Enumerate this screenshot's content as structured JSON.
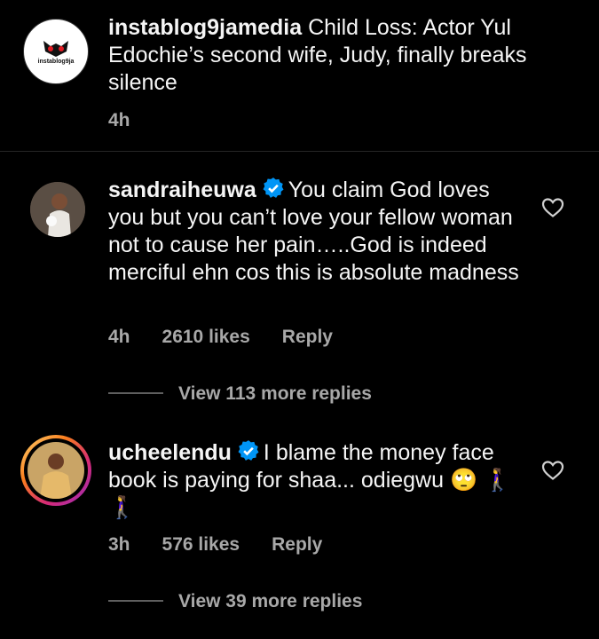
{
  "post": {
    "username": "instablog9jamedia",
    "caption": "Child Loss: Actor Yul Edochie’s second wife, Judy, finally breaks silence",
    "time": "4h",
    "logo_text": "instablog9ja"
  },
  "comments": [
    {
      "username": "sandraiheuwa",
      "verified": true,
      "text": "You claim God loves you but you can’t love your fellow woman not to cause her pain…..God is indeed merciful ehn cos this is absolute madness",
      "time": "4h",
      "likes": "2610 likes",
      "reply_label": "Reply",
      "view_replies": "View 113 more replies"
    },
    {
      "username": "ucheelendu",
      "verified": true,
      "text": "I blame the money face book is paying for shaa... odiegwu 🙄 🚶‍♀️🚶‍♀️",
      "time": "3h",
      "likes": "576 likes",
      "reply_label": "Reply",
      "view_replies": "View 39 more replies"
    }
  ],
  "colors": {
    "background": "#000000",
    "text": "#f5f5f5",
    "secondary": "#a8a8a8",
    "verified": "#0095f6",
    "divider": "#262626"
  },
  "icons": {
    "like": "heart-outline-icon",
    "verified": "verified-badge-icon"
  }
}
